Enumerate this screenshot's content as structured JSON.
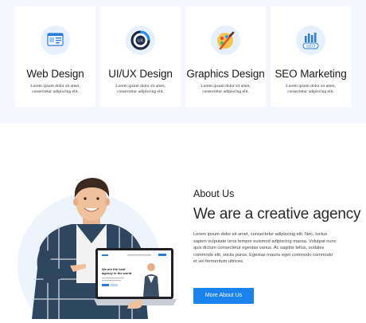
{
  "services": [
    {
      "title": "Web Design",
      "desc_line1": "Lorem ipsum dolor sit amet,",
      "desc_line2": "consectetur adipiscing elit.",
      "icon": "web-design-icon"
    },
    {
      "title": "UI/UX Design",
      "desc_line1": "Lorem ipsum dolor sit amet,",
      "desc_line2": "consectetur adipiscing elit.",
      "icon": "uiux-icon"
    },
    {
      "title": "Graphics Design",
      "desc_line1": "Lorem ipsum dolor sit amet,",
      "desc_line2": "consectetur adipiscing elit.",
      "icon": "graphics-icon"
    },
    {
      "title": "SEO Marketing",
      "desc_line1": "Lorem ipsum dolor sit amet,",
      "desc_line2": "consectetur adipiscing elit.",
      "icon": "seo-icon"
    }
  ],
  "seo_icon_text": "SEO",
  "uiux_icon_text": "UX",
  "about": {
    "heading": "About Us",
    "title": "We are a creative agency",
    "text": "Lorem ipsum dolor sit amet, consectetur adipiscing elit. Nec, luctus sapien vulputate urna tempor euismod adipiscing massa. Volutpat nunc quis dictum consectetur egestas varius. Ac sagittis tellus, sodales commodo elit, sociis purus. Egestas mauris eget commodo commodo et vel fermentum ultrices.",
    "button": "More About Us"
  },
  "laptop_screen": {
    "headline_line1": "We are the best",
    "headline_line2": "agency in the world"
  },
  "colors": {
    "accent": "#1a83ee",
    "section_bg": "#f4f7fd",
    "icon_bg": "#e6f1fd"
  }
}
